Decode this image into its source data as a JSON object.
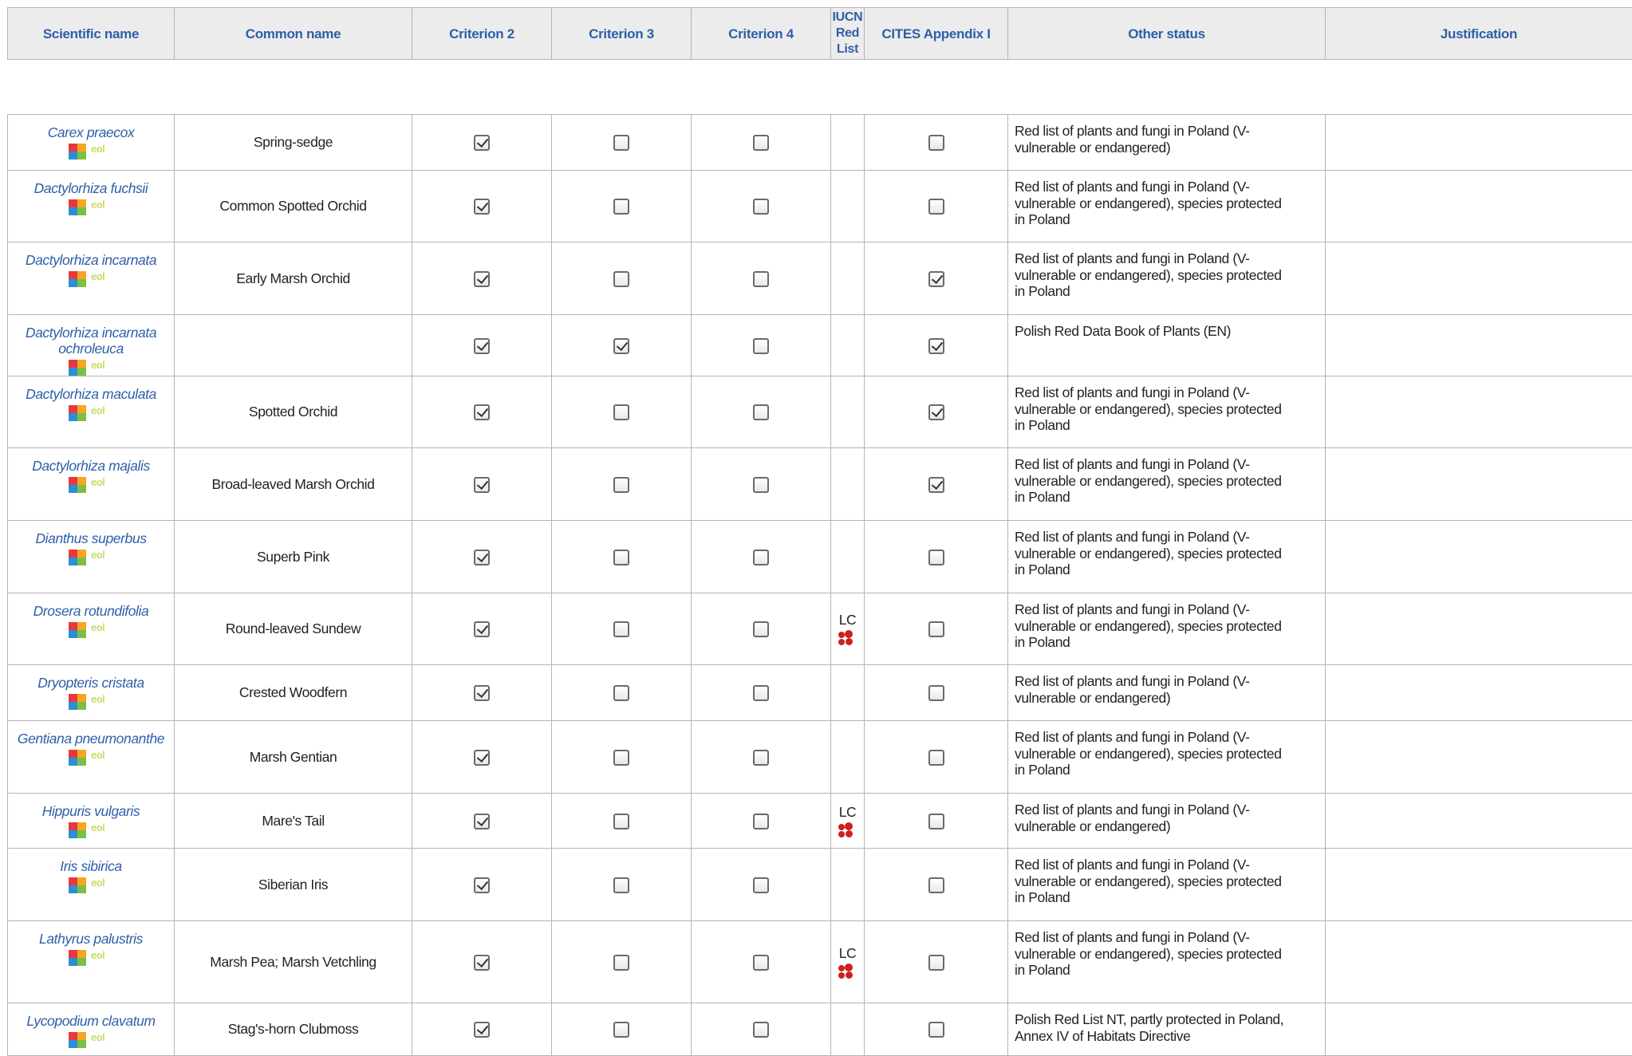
{
  "headers": {
    "scientific_name": "Scientific name",
    "common_name": "Common name",
    "criterion2": "Criterion 2",
    "criterion3": "Criterion 3",
    "criterion4": "Criterion 4",
    "iucn_red_list": "IUCN Red List",
    "cites": "CITES Appendix I",
    "other_status": "Other status",
    "justification": "Justification"
  },
  "icons": {
    "logo_a": "eol-colored-squares-logo",
    "logo_b_text": "eol",
    "red_list_logo": "iucn-red-list-icon"
  },
  "colors": {
    "header_text": "#2d5fa8",
    "header_bg": "#ececec",
    "link_text": "#2d5fa8",
    "border": "#b4b4b4"
  },
  "rows": [
    {
      "sci": "Carex praecox",
      "common": "Spring-sedge",
      "c2": true,
      "c3": false,
      "c4": false,
      "iucn": "",
      "cites": false,
      "other": "Red list of plants and fungi in Poland (V-vulnerable or endangered)"
    },
    {
      "sci": "Dactylorhiza fuchsii",
      "common": "Common Spotted Orchid",
      "c2": true,
      "c3": false,
      "c4": false,
      "iucn": "",
      "cites": false,
      "other": "Red list of plants and fungi in Poland (V-vulnerable or endangered), species protected in Poland"
    },
    {
      "sci": "Dactylorhiza incarnata",
      "common": "Early Marsh Orchid",
      "c2": true,
      "c3": false,
      "c4": false,
      "iucn": "",
      "cites": true,
      "other": "Red list of plants and fungi in Poland (V-vulnerable or endangered), species protected in Poland"
    },
    {
      "sci": "Dactylorhiza incarnata ochroleuca",
      "common": "",
      "c2": true,
      "c3": true,
      "c4": false,
      "iucn": "",
      "cites": true,
      "other": "Polish Red Data Book of Plants (EN)"
    },
    {
      "sci": "Dactylorhiza maculata",
      "common": "Spotted Orchid",
      "c2": true,
      "c3": false,
      "c4": false,
      "iucn": "",
      "cites": true,
      "other": "Red list of plants and fungi in Poland (V-vulnerable or endangered), species protected in Poland"
    },
    {
      "sci": "Dactylorhiza majalis",
      "common": "Broad-leaved Marsh Orchid",
      "c2": true,
      "c3": false,
      "c4": false,
      "iucn": "",
      "cites": true,
      "other": "Red list of plants and fungi in Poland (V-vulnerable or endangered), species protected in Poland"
    },
    {
      "sci": "Dianthus superbus",
      "common": "Superb Pink",
      "c2": true,
      "c3": false,
      "c4": false,
      "iucn": "",
      "cites": false,
      "other": "Red list of plants and fungi in Poland (V-vulnerable or endangered), species protected in Poland"
    },
    {
      "sci": "Drosera rotundifolia",
      "common": "Round-leaved Sundew",
      "c2": true,
      "c3": false,
      "c4": false,
      "iucn": "LC",
      "cites": false,
      "other": "Red list of plants and fungi in Poland (V-vulnerable or endangered), species protected in Poland"
    },
    {
      "sci": "Dryopteris cristata",
      "common": "Crested Woodfern",
      "c2": true,
      "c3": false,
      "c4": false,
      "iucn": "",
      "cites": false,
      "other": "Red list of plants and fungi in Poland (V-vulnerable or endangered)"
    },
    {
      "sci": "Gentiana pneumonanthe",
      "common": "Marsh Gentian",
      "c2": true,
      "c3": false,
      "c4": false,
      "iucn": "",
      "cites": false,
      "other": "Red list of plants and fungi in Poland (V-vulnerable or endangered), species protected in Poland"
    },
    {
      "sci": "Hippuris vulgaris",
      "common": "Mare's Tail",
      "c2": true,
      "c3": false,
      "c4": false,
      "iucn": "LC",
      "cites": false,
      "other": "Red list of plants and fungi in Poland (V-vulnerable or endangered)"
    },
    {
      "sci": "Iris sibirica",
      "common": "Siberian Iris",
      "c2": true,
      "c3": false,
      "c4": false,
      "iucn": "",
      "cites": false,
      "other": "Red list of plants and fungi in Poland (V-vulnerable or endangered), species protected in Poland"
    },
    {
      "sci": "Lathyrus palustris",
      "common": "Marsh Pea; Marsh Vetchling",
      "c2": true,
      "c3": false,
      "c4": false,
      "iucn": "LC",
      "cites": false,
      "other": "Red list of plants and fungi in Poland (V-vulnerable or endangered), species protected in Poland"
    },
    {
      "sci": "Lycopodium clavatum",
      "common": "Stag's-horn Clubmoss",
      "c2": true,
      "c3": false,
      "c4": false,
      "iucn": "",
      "cites": false,
      "other": "Polish Red List NT, partly protected in Poland, Annex IV of Habitats Directive"
    }
  ]
}
